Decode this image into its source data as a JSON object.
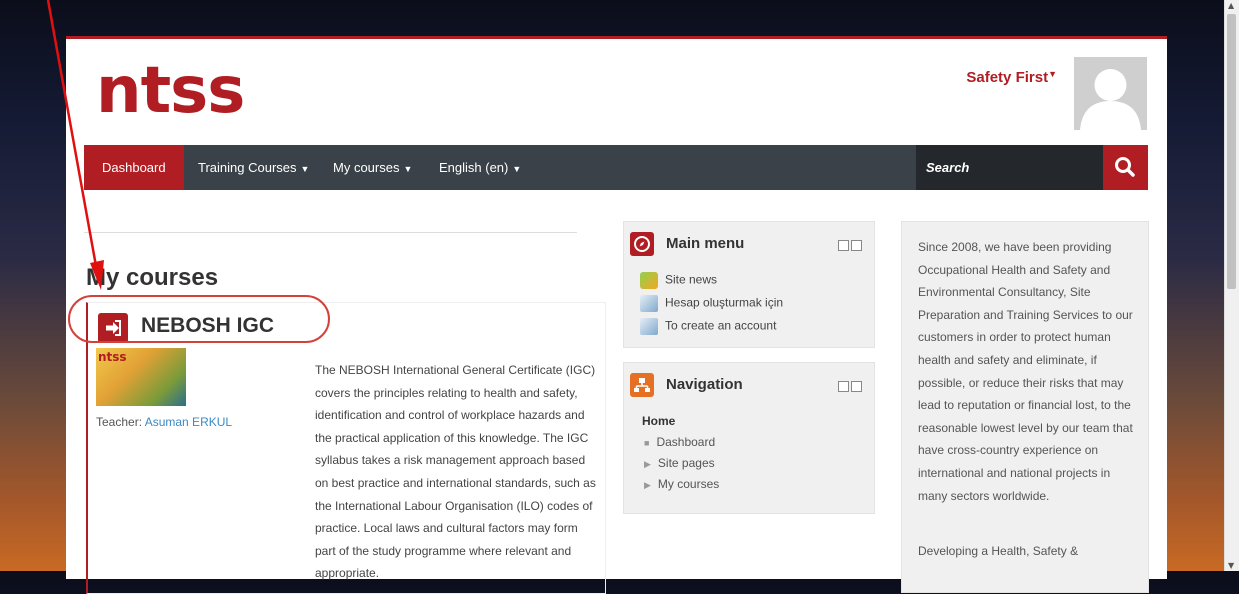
{
  "site": {
    "logo_text": "ntss"
  },
  "user": {
    "name": "Safety First"
  },
  "nav": {
    "dashboard": "Dashboard",
    "training_courses": "Training Courses",
    "my_courses": "My courses",
    "language": "English (en)",
    "search_placeholder": "Search"
  },
  "main": {
    "title": "My courses",
    "course": {
      "name": "NEBOSH IGC",
      "image_text": "ntss",
      "teacher_label": "Teacher:",
      "teacher_name": "Asuman ERKUL",
      "summary": "The NEBOSH International General Certificate (IGC) covers the principles relating to health and safety, identification and control of workplace hazards and the practical application of this knowledge. The IGC syllabus takes a risk management approach based on best practice and international standards, such as the International Labour Organisation (ILO) codes of practice.  Local laws and cultural factors may form part of the study programme where relevant and appropriate."
    }
  },
  "main_menu": {
    "title": "Main menu",
    "items": [
      "Site news",
      "Hesap oluşturmak için",
      "To create an account"
    ]
  },
  "navigation": {
    "title": "Navigation",
    "home": "Home",
    "items": [
      "Dashboard",
      "Site pages",
      "My courses"
    ]
  },
  "about": {
    "text": "Since 2008, we have been providing Occupational Health and Safety and Environmental Consultancy, Site Preparation and  Training Services to our customers in order to protect human health and safety and eliminate, if possible, or reduce their risks that may lead to reputation or financial lost, to the reasonable lowest level by our team that have cross-country experience on international and national projects in many sectors worldwide.",
    "text2": "Developing a Health, Safety &"
  },
  "colors": {
    "brand": "#b01e23",
    "navbar": "#3a4148",
    "link": "#3a8bc4"
  }
}
